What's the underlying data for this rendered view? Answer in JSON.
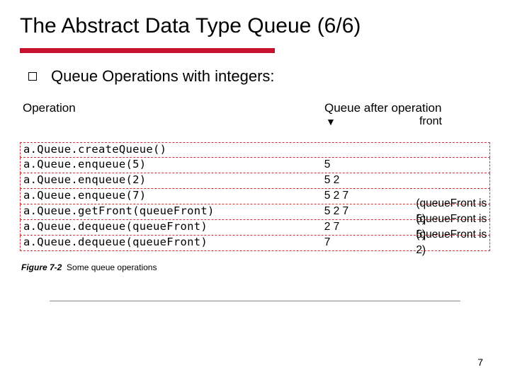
{
  "title": "The Abstract Data Type Queue (6/6)",
  "bullet": "Queue Operations with integers:",
  "headers": {
    "operation": "Operation",
    "after": "Queue after operation",
    "front": "front"
  },
  "rows": [
    {
      "call": "a.Queue.createQueue()",
      "queue": "",
      "note": ""
    },
    {
      "call": "a.Queue.enqueue(5)",
      "queue": "5",
      "note": ""
    },
    {
      "call": "a.Queue.enqueue(2)",
      "queue": "5  2",
      "note": ""
    },
    {
      "call": "a.Queue.enqueue(7)",
      "queue": "5  2  7",
      "note": ""
    },
    {
      "call": "a.Queue.getFront(queueFront)",
      "queue": "5  2  7",
      "note": "(queueFront is 5)"
    },
    {
      "call": "a.Queue.dequeue(queueFront)",
      "queue": "2  7",
      "note": "(queueFront is 5)"
    },
    {
      "call": "a.Queue.dequeue(queueFront)",
      "queue": "7",
      "note": "(queueFront is 2)"
    }
  ],
  "caption_label": "Figure 7-2",
  "caption_text": "Some queue operations",
  "page_number": "7"
}
